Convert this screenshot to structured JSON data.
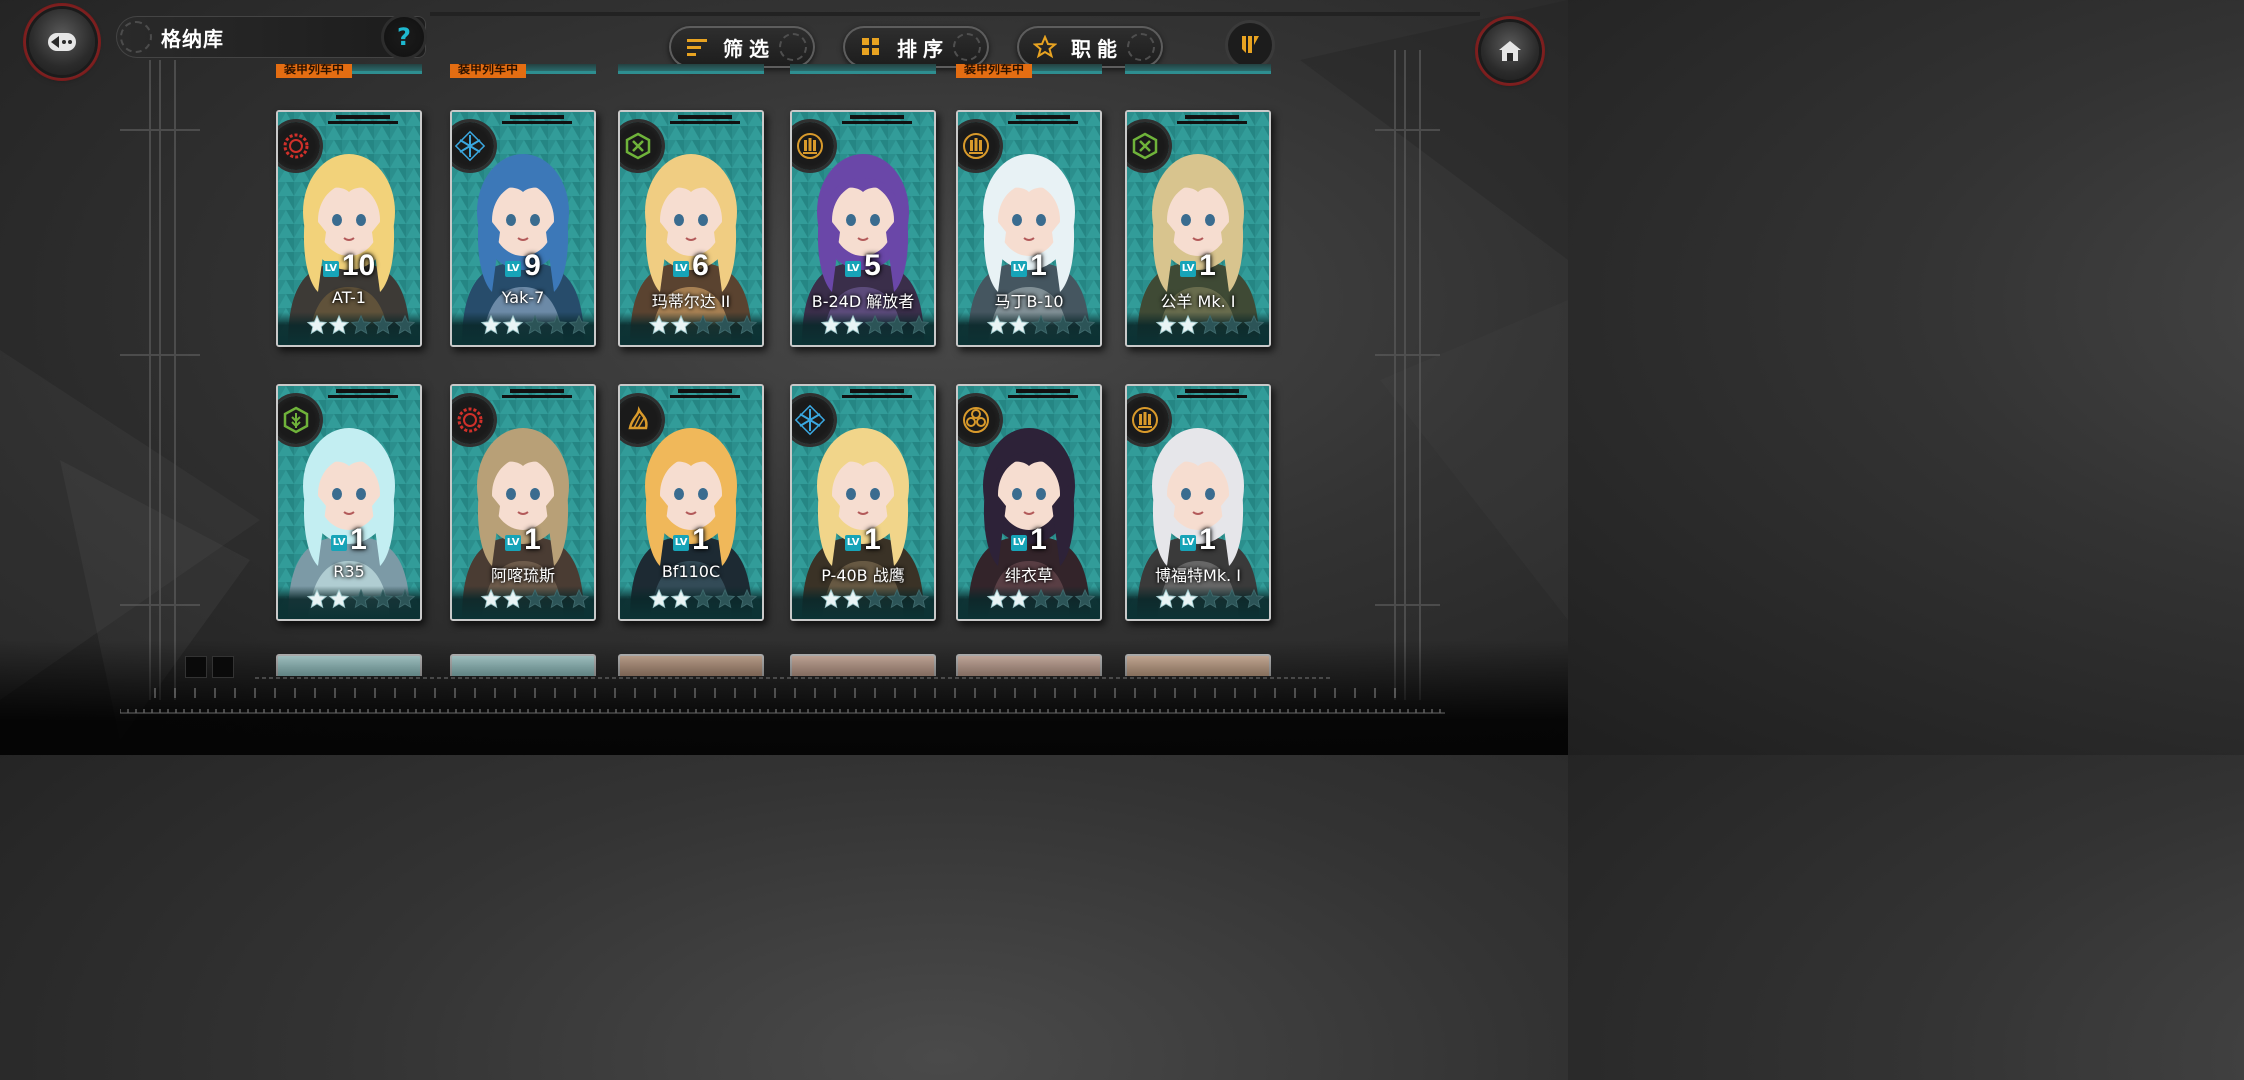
{
  "header": {
    "title": "格纳库",
    "help_label": "?",
    "filter_label": "筛选",
    "sort_label": "排序",
    "role_label": "职能"
  },
  "peek_row": {
    "tags": [
      "装甲列车中",
      "装甲列车中",
      "装甲列车中"
    ]
  },
  "cards": [
    {
      "level": "10",
      "name": "AT-1",
      "stars": 2,
      "class_icon": "red-gear-icon"
    },
    {
      "level": "9",
      "name": "Yak-7",
      "stars": 2,
      "class_icon": "blue-snowflake-icon"
    },
    {
      "level": "6",
      "name": "玛蒂尔达 II",
      "stars": 2,
      "class_icon": "green-cross-icon"
    },
    {
      "level": "5",
      "name": "B-24D 解放者",
      "stars": 2,
      "class_icon": "gold-bomb-icon"
    },
    {
      "level": "1",
      "name": "马丁B-10",
      "stars": 2,
      "class_icon": "gold-bomb-icon"
    },
    {
      "level": "1",
      "name": "公羊 Mk. I",
      "stars": 2,
      "class_icon": "green-cross-icon"
    },
    {
      "level": "1",
      "name": "R35",
      "stars": 2,
      "class_icon": "green-leaf-icon"
    },
    {
      "level": "1",
      "name": "阿喀琉斯",
      "stars": 2,
      "class_icon": "red-gear-icon"
    },
    {
      "level": "1",
      "name": "Bf110C",
      "stars": 2,
      "class_icon": "gold-flame-icon"
    },
    {
      "level": "1",
      "name": "P-40B 战鹰",
      "stars": 2,
      "class_icon": "blue-snowflake-icon"
    },
    {
      "level": "1",
      "name": "绯衣草",
      "stars": 2,
      "class_icon": "gold-triple-icon"
    },
    {
      "level": "1",
      "name": "博福特Mk. I",
      "stars": 2,
      "class_icon": "gold-bomb-icon"
    }
  ],
  "level_badge": "LV",
  "colors": {
    "accent_cyan": "#17a4b8",
    "tag_orange": "#e46d12",
    "class_red": "#d0302a",
    "class_blue": "#3aa7e0",
    "class_green": "#6fb33a",
    "class_gold": "#d99a2b"
  }
}
